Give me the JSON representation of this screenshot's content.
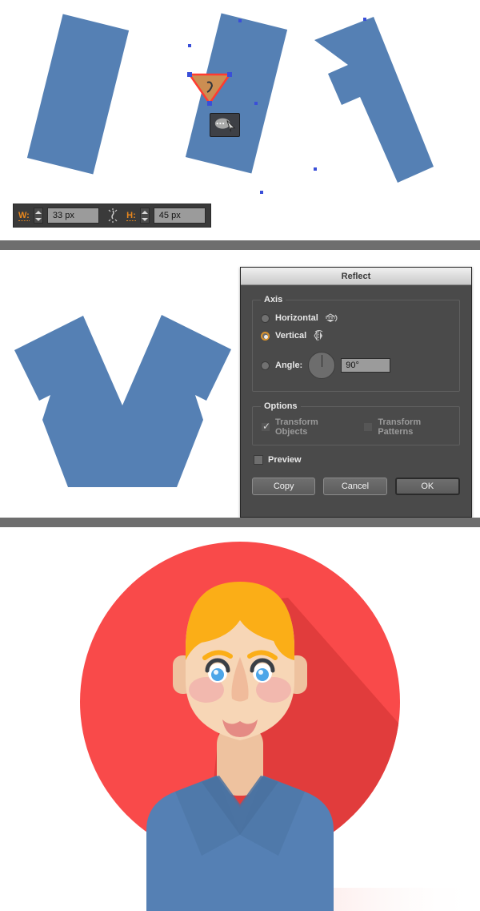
{
  "panels": {
    "shapes": {
      "name": "illustrator-shape-editing",
      "toolbar": {
        "width_label": "W:",
        "width_value": "33 px",
        "height_label": "H:",
        "height_value": "45 px",
        "link_icon": "constrain-proportions-icon"
      },
      "shape_fill": "#5580b4",
      "selection_stroke": "#ff3b30",
      "selection_fill": "#cb8e52",
      "anchor_color": "#3a4fd8",
      "tool_badge_icon": "reflect-tool-cursor-icon"
    },
    "reflect": {
      "title": "Reflect",
      "axis": {
        "legend": "Axis",
        "horizontal_label": "Horizontal",
        "horizontal_selected": false,
        "vertical_label": "Vertical",
        "vertical_selected": true,
        "angle_label": "Angle:",
        "angle_selected": false,
        "angle_value": "90°"
      },
      "options": {
        "legend": "Options",
        "transform_objects_label": "Transform Objects",
        "transform_objects_checked": true,
        "transform_patterns_label": "Transform Patterns",
        "transform_patterns_checked": false,
        "preview_label": "Preview",
        "preview_checked": false
      },
      "buttons": {
        "copy": "Copy",
        "cancel": "Cancel",
        "ok": "OK"
      },
      "accent_color": "#e0952a",
      "shape_fill": "#5580b4"
    },
    "avatar": {
      "name": "flat-avatar-illustration",
      "colors": {
        "circle_bg": "#f94a4a",
        "long_shadow": "#e13c3c",
        "hair": "#fbae17",
        "skin": "#f7d6b6",
        "skin_shadow": "#eec29f",
        "cheek": "#f2b8ae",
        "nose": "#f0bb9b",
        "mouth": "#e58b84",
        "eye_white": "#ffffff",
        "iris": "#4da6e8",
        "eyelid": "#3a3f45",
        "eyebrow": "#fbae17",
        "shirt": "#5580b4",
        "shirt_dark": "#4a719f",
        "collar": "#4a719f"
      }
    }
  }
}
